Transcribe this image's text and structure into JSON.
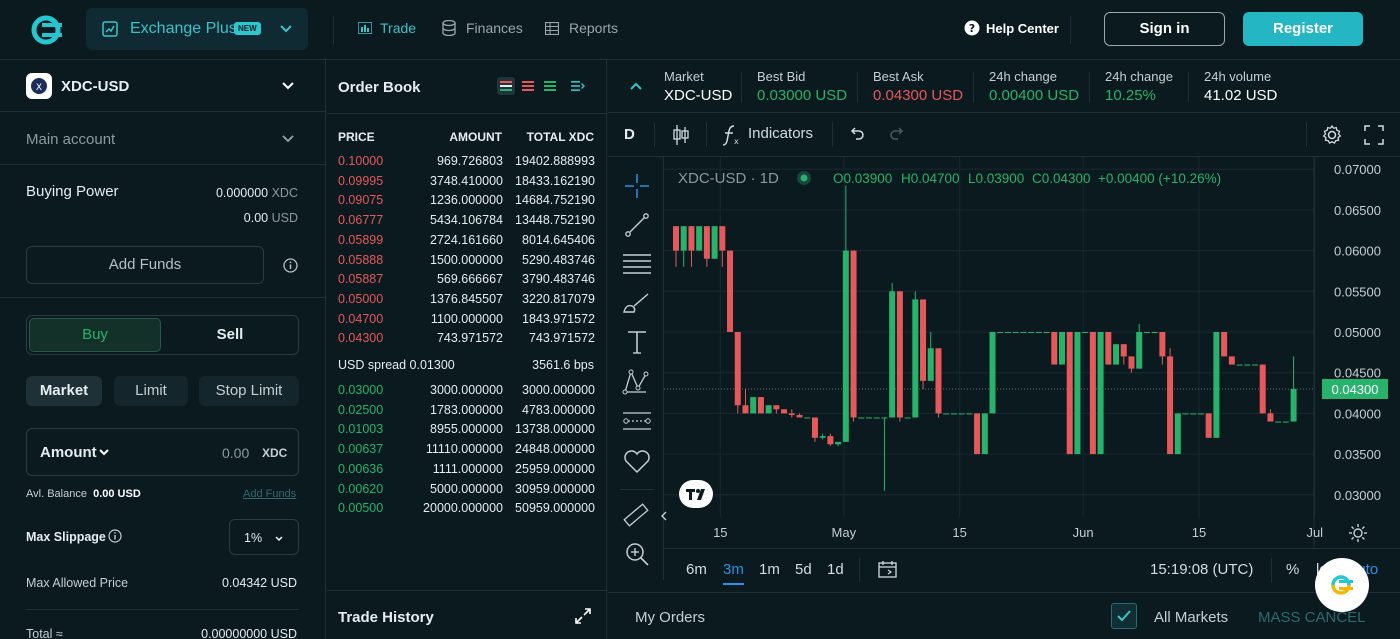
{
  "nav": {
    "product": "Exchange Plus",
    "new_badge": "NEW",
    "trade": "Trade",
    "finances": "Finances",
    "reports": "Reports",
    "help": "Help Center",
    "signin": "Sign in",
    "register": "Register"
  },
  "left": {
    "pair": "XDC-USD",
    "account": "Main account",
    "buying_power_label": "Buying Power",
    "bp_xdc": "0.000000",
    "bp_xdc_unit": "XDC",
    "bp_usd": "0.00",
    "bp_usd_unit": "USD",
    "add_funds": "Add Funds",
    "buy": "Buy",
    "sell": "Sell",
    "order_types": [
      "Market",
      "Limit",
      "Stop Limit"
    ],
    "amount_label": "Amount",
    "amount_placeholder": "0.00",
    "amount_unit": "XDC",
    "avl_balance_label": "Avl. Balance",
    "avl_balance_value": "0.00 USD",
    "add_funds_link": "Add Funds",
    "max_slippage_label": "Max Slippage",
    "max_slippage_value": "1%",
    "max_allowed_label": "Max Allowed Price",
    "max_allowed_value": "0.04342 USD",
    "total_label": "Total ≈",
    "total_value": "0.00000000 USD"
  },
  "orderbook": {
    "title": "Order Book",
    "headers": [
      "PRICE",
      "AMOUNT",
      "TOTAL XDC"
    ],
    "asks": [
      [
        "0.10000",
        "969.726803",
        "19402.888993"
      ],
      [
        "0.09995",
        "3748.410000",
        "18433.162190"
      ],
      [
        "0.09075",
        "1236.000000",
        "14684.752190"
      ],
      [
        "0.06777",
        "5434.106784",
        "13448.752190"
      ],
      [
        "0.05899",
        "2724.161660",
        "8014.645406"
      ],
      [
        "0.05888",
        "1500.000000",
        "5290.483746"
      ],
      [
        "0.05887",
        "569.666667",
        "3790.483746"
      ],
      [
        "0.05000",
        "1376.845507",
        "3220.817079"
      ],
      [
        "0.04700",
        "1100.000000",
        "1843.971572"
      ],
      [
        "0.04300",
        "743.971572",
        "743.971572"
      ]
    ],
    "spread_label": "USD spread 0.01300",
    "spread_bps": "3561.6 bps",
    "bids": [
      [
        "0.03000",
        "3000.000000",
        "3000.000000"
      ],
      [
        "0.02500",
        "1783.000000",
        "4783.000000"
      ],
      [
        "0.01003",
        "8955.000000",
        "13738.000000"
      ],
      [
        "0.00637",
        "11110.000000",
        "24848.000000"
      ],
      [
        "0.00636",
        "1111.000000",
        "25959.000000"
      ],
      [
        "0.00620",
        "5000.000000",
        "30959.000000"
      ],
      [
        "0.00500",
        "20000.000000",
        "50959.000000"
      ]
    ],
    "trade_history": "Trade History"
  },
  "ticker": [
    {
      "label": "Market",
      "value": "XDC-USD",
      "color": "#ffffff"
    },
    {
      "label": "Best Bid",
      "value": "0.03000 USD",
      "color": "#27b36b"
    },
    {
      "label": "Best Ask",
      "value": "0.04300 USD",
      "color": "#e5595c"
    },
    {
      "label": "24h change",
      "value": "0.00400 USD",
      "color": "#27b36b"
    },
    {
      "label": "24h change",
      "value": "10.25%",
      "color": "#27b36b"
    },
    {
      "label": "24h volume",
      "value": "41.02 USD",
      "color": "#ffffff"
    }
  ],
  "chart_toolbar": {
    "interval": "D",
    "indicators": "Indicators"
  },
  "chart_data": {
    "type": "candlestick",
    "symbol": "XDC-USD · 1D",
    "ohlc_legend": {
      "o": "O0.03900",
      "h": "H0.04700",
      "l": "L0.03900",
      "c": "C0.04300",
      "chg": "+0.00400 (+10.26%)"
    },
    "ylim": [
      0.0285,
      0.0715
    ],
    "y_ticks": [
      "0.07000",
      "0.06500",
      "0.06000",
      "0.05500",
      "0.05000",
      "0.04500",
      "0.04000",
      "0.03500",
      "0.03000"
    ],
    "y_tick_values": [
      0.07,
      0.065,
      0.06,
      0.055,
      0.05,
      0.045,
      0.04,
      0.035,
      0.03
    ],
    "x_ticks": [
      "15",
      "May",
      "15",
      "Jun",
      "15",
      "Jul",
      "15"
    ],
    "x_tick_days": [
      14,
      30,
      45,
      61,
      76,
      91,
      106
    ],
    "last_price": "0.04300",
    "last_value": 0.043,
    "up_color": "#27b36b",
    "down_color": "#e5595c",
    "candles": [
      [
        0,
        0.063,
        0.063,
        0.058,
        0.06
      ],
      [
        1,
        0.06,
        0.063,
        0.058,
        0.063
      ],
      [
        2,
        0.063,
        0.063,
        0.058,
        0.06
      ],
      [
        3,
        0.06,
        0.063,
        0.06,
        0.063
      ],
      [
        4,
        0.063,
        0.063,
        0.058,
        0.059
      ],
      [
        5,
        0.059,
        0.063,
        0.059,
        0.063
      ],
      [
        6,
        0.063,
        0.063,
        0.058,
        0.06
      ],
      [
        7,
        0.06,
        0.06,
        0.05,
        0.05
      ],
      [
        8,
        0.05,
        0.05,
        0.04,
        0.041
      ],
      [
        9,
        0.041,
        0.043,
        0.04,
        0.04
      ],
      [
        10,
        0.04,
        0.042,
        0.04,
        0.042
      ],
      [
        11,
        0.042,
        0.042,
        0.04,
        0.04
      ],
      [
        12,
        0.04,
        0.041,
        0.04,
        0.041
      ],
      [
        13,
        0.041,
        0.041,
        0.04,
        0.0405
      ],
      [
        14,
        0.0405,
        0.0405,
        0.04,
        0.04
      ],
      [
        15,
        0.04,
        0.0405,
        0.0395,
        0.0398
      ],
      [
        16,
        0.0398,
        0.04,
        0.0395,
        0.0395
      ],
      [
        17,
        0.0395,
        0.0395,
        0.0395,
        0.0395
      ],
      [
        18,
        0.0395,
        0.0395,
        0.0365,
        0.037
      ],
      [
        19,
        0.037,
        0.0375,
        0.0368,
        0.0372
      ],
      [
        20,
        0.0372,
        0.0375,
        0.036,
        0.0362
      ],
      [
        21,
        0.0362,
        0.0365,
        0.036,
        0.0365
      ],
      [
        22,
        0.0365,
        0.068,
        0.0365,
        0.06
      ],
      [
        23,
        0.06,
        0.06,
        0.039,
        0.0395
      ],
      [
        24,
        0.0395,
        0.0395,
        0.0395,
        0.0395
      ],
      [
        25,
        0.0395,
        0.0395,
        0.0395,
        0.0395
      ],
      [
        26,
        0.0395,
        0.0395,
        0.0395,
        0.0395
      ],
      [
        27,
        0.0395,
        0.0395,
        0.0305,
        0.0395
      ],
      [
        28,
        0.0395,
        0.056,
        0.0395,
        0.055
      ],
      [
        29,
        0.055,
        0.055,
        0.039,
        0.0395
      ],
      [
        30,
        0.0395,
        0.0395,
        0.0395,
        0.0395
      ],
      [
        31,
        0.0395,
        0.055,
        0.0395,
        0.054
      ],
      [
        32,
        0.054,
        0.054,
        0.043,
        0.044
      ],
      [
        33,
        0.044,
        0.05,
        0.044,
        0.048
      ],
      [
        34,
        0.048,
        0.048,
        0.0395,
        0.04
      ],
      [
        35,
        0.04,
        0.04,
        0.04,
        0.04
      ],
      [
        36,
        0.04,
        0.04,
        0.04,
        0.04
      ],
      [
        37,
        0.04,
        0.04,
        0.04,
        0.04
      ],
      [
        38,
        0.04,
        0.04,
        0.04,
        0.04
      ],
      [
        39,
        0.04,
        0.04,
        0.035,
        0.035
      ],
      [
        40,
        0.035,
        0.04,
        0.035,
        0.04
      ],
      [
        41,
        0.04,
        0.05,
        0.04,
        0.05
      ],
      [
        42,
        0.05,
        0.05,
        0.05,
        0.05
      ],
      [
        43,
        0.05,
        0.05,
        0.05,
        0.05
      ],
      [
        44,
        0.05,
        0.05,
        0.05,
        0.05
      ],
      [
        45,
        0.05,
        0.05,
        0.05,
        0.05
      ],
      [
        46,
        0.05,
        0.05,
        0.05,
        0.05
      ],
      [
        47,
        0.05,
        0.05,
        0.05,
        0.05
      ],
      [
        48,
        0.05,
        0.05,
        0.05,
        0.05
      ],
      [
        49,
        0.05,
        0.05,
        0.046,
        0.046
      ],
      [
        50,
        0.046,
        0.05,
        0.046,
        0.05
      ],
      [
        51,
        0.05,
        0.05,
        0.035,
        0.035
      ],
      [
        52,
        0.035,
        0.05,
        0.035,
        0.05
      ],
      [
        53,
        0.05,
        0.05,
        0.05,
        0.05
      ],
      [
        54,
        0.05,
        0.05,
        0.035,
        0.035
      ],
      [
        55,
        0.035,
        0.05,
        0.035,
        0.05
      ],
      [
        56,
        0.05,
        0.05,
        0.046,
        0.046
      ],
      [
        57,
        0.046,
        0.0485,
        0.046,
        0.0485
      ],
      [
        58,
        0.0485,
        0.0485,
        0.046,
        0.047
      ],
      [
        59,
        0.047,
        0.047,
        0.045,
        0.0455
      ],
      [
        60,
        0.0455,
        0.051,
        0.0455,
        0.05
      ],
      [
        61,
        0.05,
        0.05,
        0.05,
        0.05
      ],
      [
        62,
        0.05,
        0.05,
        0.05,
        0.05
      ],
      [
        63,
        0.05,
        0.05,
        0.046,
        0.047
      ],
      [
        64,
        0.047,
        0.048,
        0.035,
        0.035
      ],
      [
        65,
        0.035,
        0.04,
        0.035,
        0.04
      ],
      [
        66,
        0.04,
        0.04,
        0.04,
        0.04
      ],
      [
        67,
        0.04,
        0.04,
        0.04,
        0.04
      ],
      [
        68,
        0.04,
        0.04,
        0.04,
        0.04
      ],
      [
        69,
        0.04,
        0.04,
        0.037,
        0.037
      ],
      [
        70,
        0.037,
        0.05,
        0.037,
        0.05
      ],
      [
        71,
        0.05,
        0.05,
        0.047,
        0.047
      ],
      [
        72,
        0.047,
        0.047,
        0.046,
        0.046
      ],
      [
        73,
        0.046,
        0.046,
        0.046,
        0.046
      ],
      [
        74,
        0.046,
        0.046,
        0.046,
        0.046
      ],
      [
        75,
        0.046,
        0.046,
        0.046,
        0.046
      ],
      [
        76,
        0.046,
        0.046,
        0.04,
        0.04
      ],
      [
        77,
        0.04,
        0.0405,
        0.039,
        0.039
      ],
      [
        78,
        0.039,
        0.039,
        0.039,
        0.039
      ],
      [
        79,
        0.039,
        0.039,
        0.039,
        0.039
      ],
      [
        80,
        0.039,
        0.047,
        0.039,
        0.043
      ]
    ],
    "x_start_day": 8
  },
  "bottom_bar": {
    "ranges": [
      "6m",
      "3m",
      "1m",
      "5d",
      "1d"
    ],
    "active_range": "3m",
    "clock": "15:19:08 (UTC)",
    "percent": "%",
    "log": "log",
    "auto": "auto"
  },
  "orders": {
    "my_orders": "My Orders",
    "all_markets": "All Markets",
    "mass_cancel": "MASS CANCEL"
  }
}
